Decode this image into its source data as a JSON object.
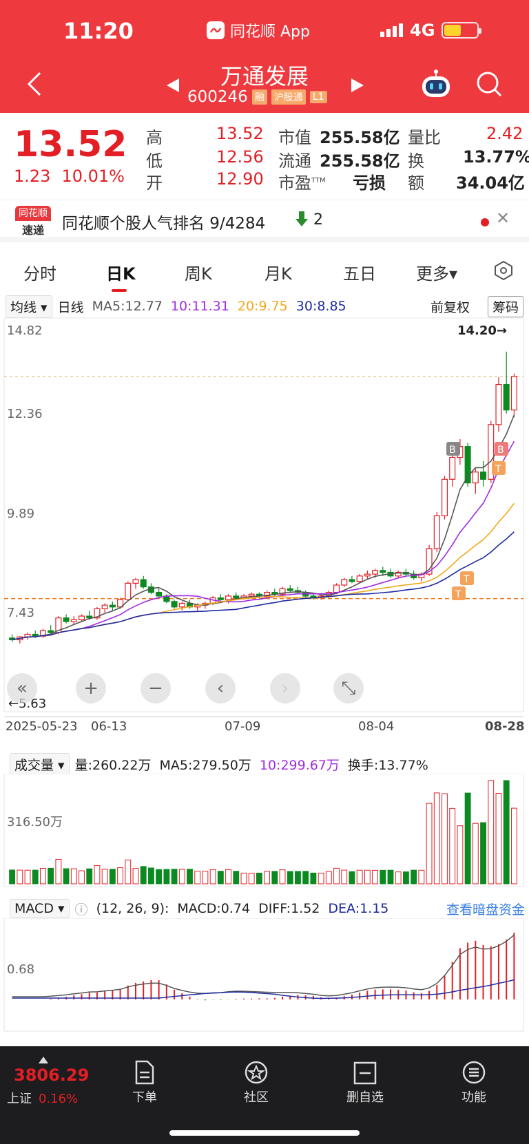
{
  "status_bar": {
    "time": "11:20",
    "app": "同花顺 App",
    "network": "4G"
  },
  "header": {
    "stock_name": "万通发展",
    "stock_code": "600246",
    "tags": [
      "融",
      "沪股通",
      "L1"
    ]
  },
  "quote": {
    "price": "13.52",
    "change": "1.23",
    "change_pct": "10.01%",
    "high_label": "高",
    "high": "13.52",
    "low_label": "低",
    "low": "12.56",
    "open_label": "开",
    "open": "12.90",
    "mcap_label": "市值",
    "mcap": "255.58亿",
    "float_label": "流通",
    "float": "255.58亿",
    "pe_label": "市盈",
    "pe_sup": "TTM",
    "pe": "亏损",
    "vr_label": "量比",
    "vr": "2.42",
    "turnover_label": "换",
    "turnover": "13.77%",
    "amount_label": "额",
    "amount": "34.04亿"
  },
  "rank": {
    "logo_top": "同花顺",
    "logo_bottom": "速递",
    "text": "同花顺个股人气排名 9/4284",
    "delta": "2"
  },
  "tabs": [
    "分时",
    "日K",
    "周K",
    "月K",
    "五日",
    "更多▾"
  ],
  "ma_row": {
    "type": "均线",
    "period": "日线",
    "ma5": "MA5:12.77",
    "ma10": "10:11.31",
    "ma20": "20:9.75",
    "ma30": "30:8.85",
    "adjust": "前复权",
    "chips": "筹码"
  },
  "kline": {
    "y_ticks": [
      "14.82",
      "12.36",
      "9.89",
      "7.43"
    ],
    "max_note": "14.20→",
    "min_note": "←5.63",
    "dates": [
      "2025-05-23",
      "06-13",
      "07-09",
      "08-04",
      "08-28"
    ]
  },
  "volume": {
    "label": "成交量",
    "vol": "量:260.22万",
    "ma5": "MA5:279.50万",
    "ma10": "10:299.67万",
    "turnover": "换手:13.77%",
    "y_tick": "316.50万"
  },
  "macd": {
    "label": "MACD",
    "params": "(12, 26, 9):",
    "macd": "MACD:0.74",
    "diff": "DIFF:1.52",
    "dea": "DEA:1.15",
    "link": "查看暗盘资金",
    "y_tick": "0.68"
  },
  "footer": {
    "index_value": "3806.29",
    "index_name": "上证",
    "index_pct": "0.16%",
    "items": [
      "下单",
      "社区",
      "删自选",
      "功能"
    ]
  },
  "colors": {
    "up": "#e31e24",
    "down": "#0b8a21",
    "ma5": "#555555",
    "ma10": "#a12be3",
    "ma20": "#f0a81c",
    "ma30": "#1e2aa0",
    "header": "#ee3a3f"
  },
  "chart_data": {
    "type": "candlestick",
    "title": "",
    "ylim": [
      5.63,
      14.82
    ],
    "candles_ohlc": [
      [
        6.35,
        6.45,
        6.25,
        6.3
      ],
      [
        6.3,
        6.4,
        6.2,
        6.38
      ],
      [
        6.38,
        6.5,
        6.3,
        6.45
      ],
      [
        6.45,
        6.55,
        6.35,
        6.4
      ],
      [
        6.4,
        6.6,
        6.35,
        6.55
      ],
      [
        6.55,
        6.7,
        6.45,
        6.5
      ],
      [
        6.5,
        6.95,
        6.45,
        6.9
      ],
      [
        6.9,
        7.0,
        6.75,
        6.8
      ],
      [
        6.8,
        6.95,
        6.7,
        6.85
      ],
      [
        6.85,
        7.0,
        6.8,
        6.95
      ],
      [
        6.95,
        7.1,
        6.85,
        6.9
      ],
      [
        6.9,
        7.2,
        6.85,
        7.15
      ],
      [
        7.15,
        7.3,
        7.05,
        7.25
      ],
      [
        7.25,
        7.35,
        7.1,
        7.2
      ],
      [
        7.2,
        7.45,
        7.15,
        7.4
      ],
      [
        7.4,
        7.9,
        7.35,
        7.85
      ],
      [
        7.85,
        8.0,
        7.7,
        7.95
      ],
      [
        7.95,
        8.05,
        7.7,
        7.75
      ],
      [
        7.75,
        7.85,
        7.55,
        7.6
      ],
      [
        7.6,
        7.7,
        7.45,
        7.5
      ],
      [
        7.5,
        7.55,
        7.3,
        7.35
      ],
      [
        7.35,
        7.4,
        7.15,
        7.2
      ],
      [
        7.2,
        7.35,
        7.1,
        7.3
      ],
      [
        7.3,
        7.4,
        7.15,
        7.2
      ],
      [
        7.2,
        7.3,
        7.1,
        7.25
      ],
      [
        7.25,
        7.35,
        7.15,
        7.3
      ],
      [
        7.3,
        7.5,
        7.25,
        7.45
      ],
      [
        7.45,
        7.55,
        7.35,
        7.4
      ],
      [
        7.4,
        7.55,
        7.3,
        7.5
      ],
      [
        7.5,
        7.6,
        7.4,
        7.45
      ],
      [
        7.45,
        7.55,
        7.4,
        7.5
      ],
      [
        7.5,
        7.6,
        7.45,
        7.55
      ],
      [
        7.55,
        7.6,
        7.45,
        7.5
      ],
      [
        7.5,
        7.65,
        7.45,
        7.6
      ],
      [
        7.6,
        7.7,
        7.5,
        7.55
      ],
      [
        7.55,
        7.75,
        7.5,
        7.7
      ],
      [
        7.7,
        7.8,
        7.6,
        7.65
      ],
      [
        7.65,
        7.75,
        7.55,
        7.6
      ],
      [
        7.6,
        7.65,
        7.45,
        7.5
      ],
      [
        7.5,
        7.55,
        7.4,
        7.45
      ],
      [
        7.45,
        7.55,
        7.4,
        7.5
      ],
      [
        7.5,
        7.65,
        7.45,
        7.6
      ],
      [
        7.6,
        7.85,
        7.55,
        7.8
      ],
      [
        7.8,
        8.0,
        7.75,
        7.95
      ],
      [
        7.95,
        8.05,
        7.85,
        7.9
      ],
      [
        7.9,
        8.1,
        7.85,
        8.05
      ],
      [
        8.05,
        8.2,
        7.95,
        8.1
      ],
      [
        8.1,
        8.25,
        8.0,
        8.2
      ],
      [
        8.2,
        8.3,
        8.05,
        8.15
      ],
      [
        8.15,
        8.25,
        8.0,
        8.05
      ],
      [
        8.05,
        8.2,
        8.0,
        8.15
      ],
      [
        8.15,
        8.25,
        8.05,
        8.1
      ],
      [
        8.1,
        8.2,
        7.95,
        8.0
      ],
      [
        8.0,
        8.15,
        7.9,
        8.1
      ],
      [
        8.1,
        8.9,
        8.05,
        8.8
      ],
      [
        8.8,
        9.8,
        8.7,
        9.7
      ],
      [
        9.7,
        10.8,
        9.6,
        10.7
      ],
      [
        10.7,
        11.5,
        10.5,
        11.3
      ],
      [
        11.3,
        11.8,
        11.1,
        11.6
      ],
      [
        11.6,
        11.7,
        10.5,
        10.6
      ],
      [
        10.6,
        11.0,
        10.3,
        10.9
      ],
      [
        10.9,
        11.2,
        10.5,
        10.7
      ],
      [
        10.7,
        12.3,
        10.6,
        12.2
      ],
      [
        12.2,
        13.5,
        12.0,
        13.3
      ],
      [
        13.3,
        14.2,
        12.5,
        12.6
      ],
      [
        12.6,
        13.6,
        12.4,
        13.52
      ]
    ]
  }
}
